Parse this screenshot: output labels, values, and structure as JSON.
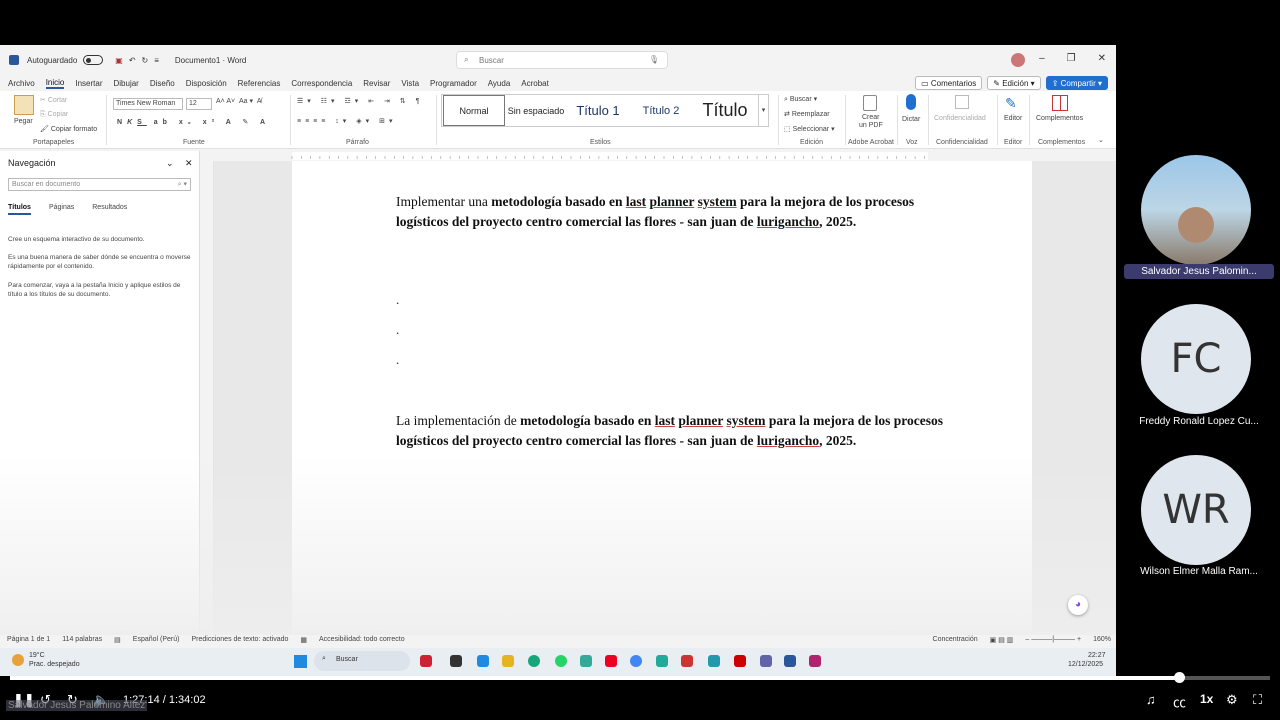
{
  "titlebar": {
    "autosave": "Autoguardado",
    "doc_title": "Documento1 · Word",
    "search_placeholder": "Buscar"
  },
  "menu": [
    "Archivo",
    "Inicio",
    "Insertar",
    "Dibujar",
    "Diseño",
    "Disposición",
    "Referencias",
    "Correspondencia",
    "Revisar",
    "Vista",
    "Programador",
    "Ayuda",
    "Acrobat"
  ],
  "ribbon_buttons": {
    "comments": "Comentarios",
    "editing": "Edición",
    "share": "Compartir"
  },
  "clipboard": {
    "paste": "Pegar",
    "cut": "Cortar",
    "copy": "Copiar",
    "format": "Copiar formato",
    "group": "Portapapeles"
  },
  "font": {
    "name": "Times New Roman",
    "size": "12",
    "group": "Fuente"
  },
  "paragraph": {
    "group": "Párrafo"
  },
  "styles": {
    "items": [
      "Normal",
      "Sin espaciado",
      "Título 1",
      "Título 2",
      "Título"
    ],
    "group": "Estilos"
  },
  "editing": {
    "find": "Buscar",
    "replace": "Reemplazar",
    "select": "Seleccionar",
    "group": "Edición"
  },
  "acrobat": {
    "create": "Crear",
    "pdf": "un PDF",
    "group": "Adobe Acrobat"
  },
  "voice": {
    "dictate": "Dictar",
    "group": "Voz"
  },
  "confidential": {
    "label": "Confidencialidad",
    "group": "Confidencialidad"
  },
  "editor": {
    "label": "Editor",
    "group": "Editor"
  },
  "addins": {
    "label": "Complementos",
    "group": "Complementos"
  },
  "nav": {
    "title": "Navegación",
    "search_placeholder": "Buscar en documento",
    "tabs": [
      "Títulos",
      "Páginas",
      "Resultados"
    ],
    "text1": "Cree un esquema interactivo de su documento.",
    "text2": "Es una buena manera de saber dónde se encuentra o moverse rápidamente por el contenido.",
    "text3": "Para comenzar, vaya a la pestaña Inicio y aplique estilos de título a los títulos de su documento."
  },
  "doc": {
    "p1_a": "Implementar una ",
    "p1_b": "metodología basado en ",
    "p1_c": "last",
    "p1_d": " ",
    "p1_e": "planner",
    "p1_f": " ",
    "p1_g": "system",
    "p1_h": " para la mejora de los procesos logísticos del proyecto centro comercial las flores - san juan de ",
    "p1_i": "lurigancho",
    ", 2025.": "",
    "p1_j": ", 2025.",
    "dots": [
      ".",
      ".",
      "."
    ],
    "p2_a": "La implementación de ",
    "p2_b": "metodología basado en ",
    "p2_c": "last",
    "p2_e": "planner",
    "p2_g": "system",
    "p2_h": " para la mejora de los procesos logísticos del proyecto centro comercial las flores - san juan de ",
    "p2_i": "lurigancho",
    "p2_j": ", 2025."
  },
  "status": {
    "page": "Página 1 de 1",
    "words": "114 palabras",
    "lang": "Español (Perú)",
    "predict": "Predicciones de texto: activado",
    "access": "Accesibilidad: todo correcto",
    "focus": "Concentración",
    "zoom": "160%"
  },
  "taskbar": {
    "temp": "19°C",
    "weather": "Prac. despejado",
    "search": "Buscar",
    "time": "22:27",
    "date": "12/12/2025"
  },
  "participants": [
    {
      "name": "Salvador Jesus Palomin...",
      "initials": ""
    },
    {
      "name": "Freddy Ronald Lopez Cu...",
      "initials": "FC"
    },
    {
      "name": "Wilson Elmer Malla Ram...",
      "initials": "WR"
    }
  ],
  "player": {
    "time": "1:27:14 / 1:34:02",
    "speed": "1x",
    "overlay_name": "Salvador Jesus Palomino Altez",
    "progress": 0.928
  }
}
